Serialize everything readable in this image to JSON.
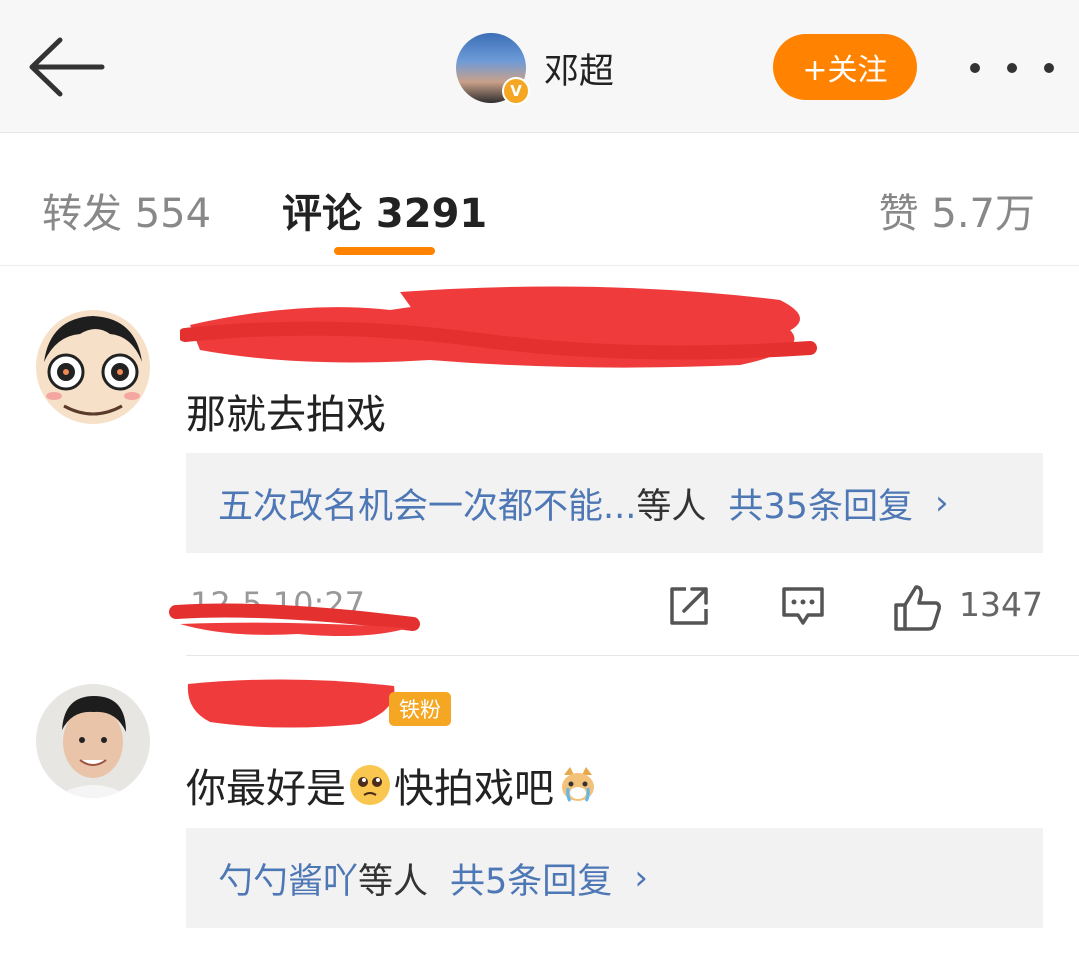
{
  "header": {
    "back_icon": "arrow-left-icon",
    "user_name": "邓超",
    "follow_label": "+关注",
    "more_icon": "more-dots-icon",
    "accent_color": "#ff8200"
  },
  "tabs": {
    "repost": "转发 554",
    "comments": "评论 3291",
    "likes": "赞 5.7万"
  },
  "comments": [
    {
      "text": "那就去拍戏",
      "reply_preview": {
        "replier": "五次改名机会一次都不能...",
        "etc": "等人",
        "total": "共35条回复"
      },
      "time": "12-5 10:27",
      "likes": "1347"
    },
    {
      "badge": "铁粉",
      "text_before": "你最好是",
      "emoji_1": "pleading-face-emoji",
      "text_after": "快拍戏吧",
      "emoji_2": "crying-dog-emoji",
      "reply_preview": {
        "replier": "勺勺酱吖",
        "etc": "等人",
        "total": "共5条回复"
      }
    }
  ],
  "link_color": "#4e77b5"
}
